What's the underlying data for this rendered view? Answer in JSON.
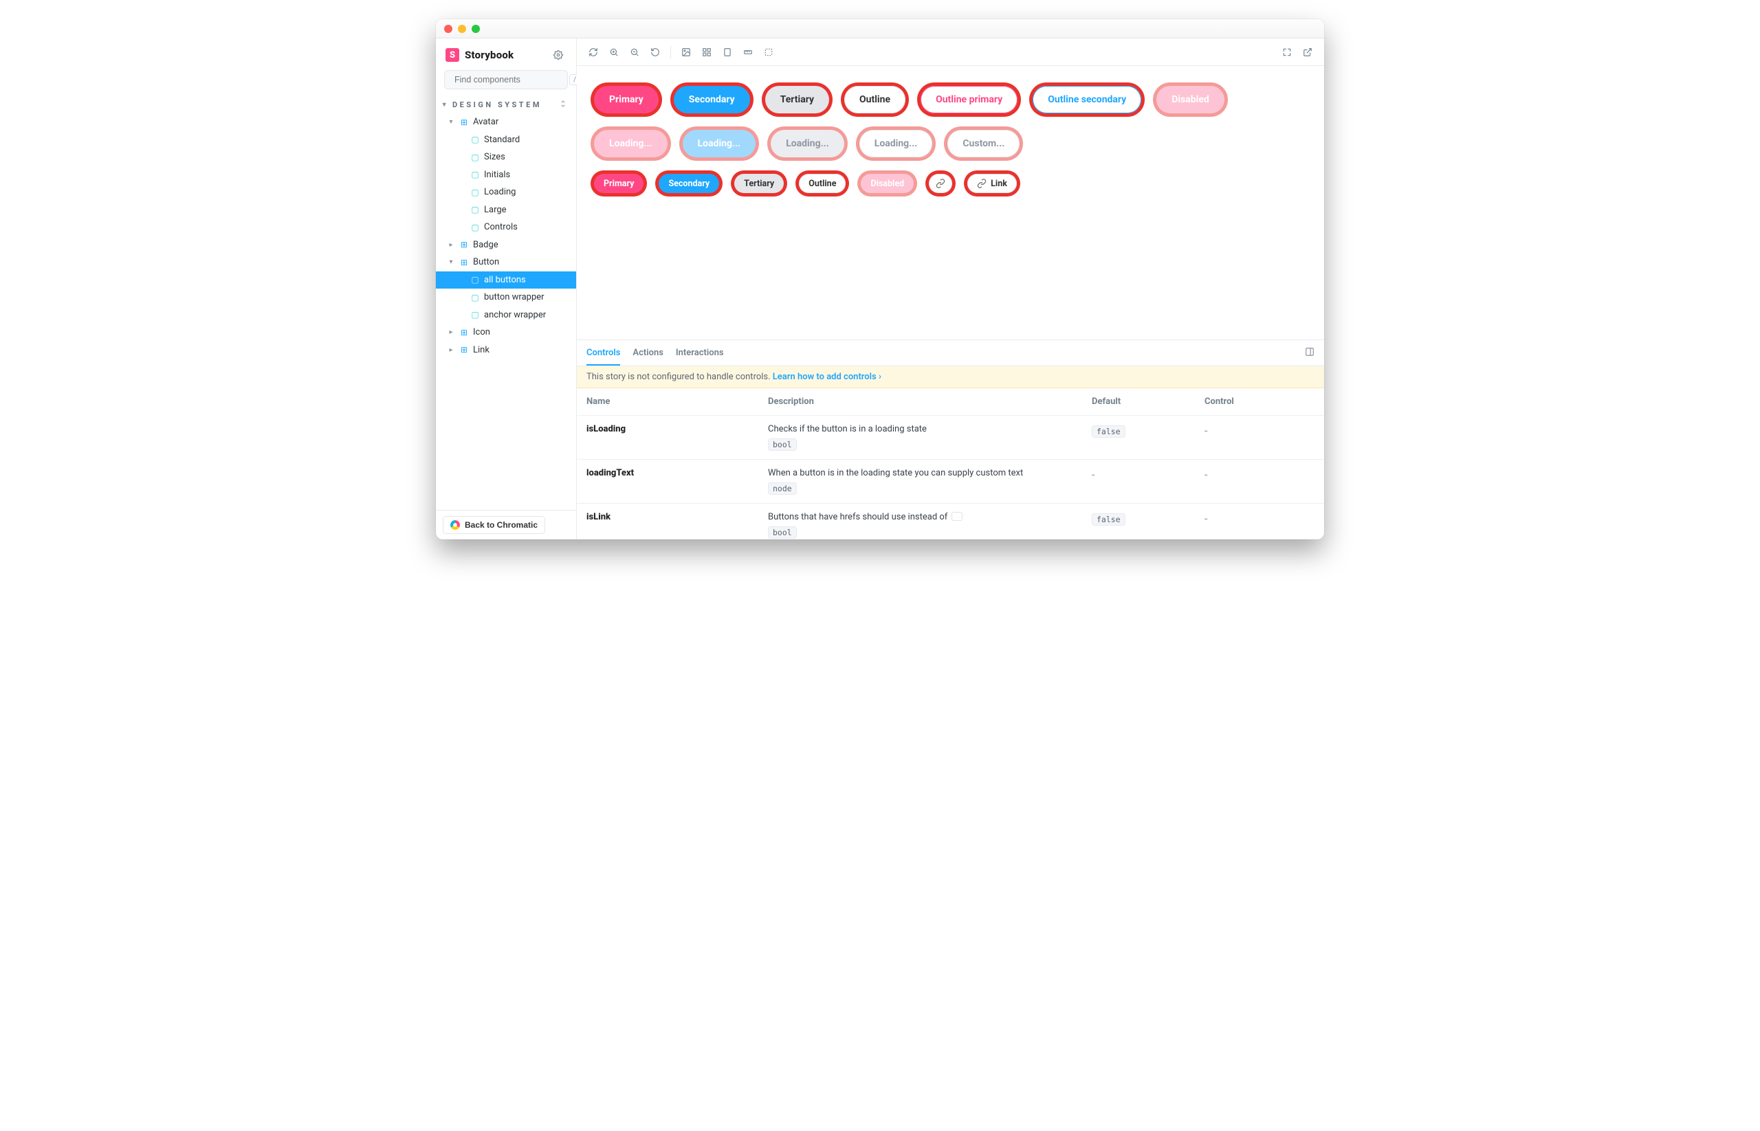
{
  "brand": {
    "name": "Storybook",
    "mark": "S"
  },
  "search": {
    "placeholder": "Find components",
    "shortcut": "/"
  },
  "section": {
    "title": "Design System"
  },
  "nav": [
    {
      "kind": "component",
      "state": "open",
      "label": "Avatar"
    },
    {
      "kind": "story",
      "state": "none",
      "label": "Standard",
      "indent": 2
    },
    {
      "kind": "story",
      "state": "none",
      "label": "Sizes",
      "indent": 2
    },
    {
      "kind": "story",
      "state": "none",
      "label": "Initials",
      "indent": 2
    },
    {
      "kind": "story",
      "state": "none",
      "label": "Loading",
      "indent": 2
    },
    {
      "kind": "story",
      "state": "none",
      "label": "Large",
      "indent": 2
    },
    {
      "kind": "story",
      "state": "none",
      "label": "Controls",
      "indent": 2
    },
    {
      "kind": "component",
      "state": "closed",
      "label": "Badge"
    },
    {
      "kind": "component",
      "state": "open",
      "label": "Button"
    },
    {
      "kind": "story",
      "state": "none",
      "label": "all buttons",
      "indent": 2,
      "selected": true
    },
    {
      "kind": "story",
      "state": "none",
      "label": "button wrapper",
      "indent": 2
    },
    {
      "kind": "story",
      "state": "none",
      "label": "anchor wrapper",
      "indent": 2
    },
    {
      "kind": "component",
      "state": "closed",
      "label": "Icon"
    },
    {
      "kind": "component",
      "state": "closed",
      "label": "Link"
    }
  ],
  "sidebarFooter": {
    "back": "Back to Chromatic"
  },
  "canvas": {
    "rows": [
      {
        "size": "lg",
        "buttons": [
          {
            "label": "Primary",
            "variant": "pink",
            "hl": "#e9322d"
          },
          {
            "label": "Secondary",
            "variant": "blue",
            "hl": "#e9322d"
          },
          {
            "label": "Tertiary",
            "variant": "grey",
            "hl": "#e9322d"
          },
          {
            "label": "Outline",
            "variant": "outl",
            "hl": "#e9322d"
          },
          {
            "label": "Outline primary",
            "variant": "outl-p",
            "hl": "#e9322d"
          },
          {
            "label": "Outline secondary",
            "variant": "outl-s",
            "hl": "#e9322d"
          },
          {
            "label": "Disabled",
            "variant": "pinklt",
            "hl": "#f49b98"
          }
        ]
      },
      {
        "size": "lg",
        "buttons": [
          {
            "label": "Loading...",
            "variant": "pinklt",
            "hl": "#f49b98"
          },
          {
            "label": "Loading...",
            "variant": "bluelt",
            "hl": "#f49b98"
          },
          {
            "label": "Loading...",
            "variant": "greylt",
            "hl": "#f49b98"
          },
          {
            "label": "Loading...",
            "variant": "outllt",
            "hl": "#f49b98"
          },
          {
            "label": "Custom...",
            "variant": "outllt",
            "hl": "#f49b98"
          }
        ]
      },
      {
        "size": "sm",
        "buttons": [
          {
            "label": "Primary",
            "variant": "pink",
            "hl": "#e9322d"
          },
          {
            "label": "Secondary",
            "variant": "blue",
            "hl": "#e9322d"
          },
          {
            "label": "Tertiary",
            "variant": "grey",
            "hl": "#e9322d"
          },
          {
            "label": "Outline",
            "variant": "outl",
            "hl": "#e9322d"
          },
          {
            "label": "Disabled",
            "variant": "pinklt",
            "hl": "#f49b98"
          },
          {
            "icon": "link",
            "label": "",
            "variant": "outl",
            "hl": "#e9322d"
          },
          {
            "icon": "link",
            "label": "Link",
            "variant": "outl",
            "hl": "#e9322d"
          }
        ]
      }
    ]
  },
  "addons": {
    "tabs": [
      "Controls",
      "Actions",
      "Interactions"
    ],
    "activeTab": 0,
    "banner": {
      "text": "This story is not configured to handle controls. ",
      "link": "Learn how to add controls"
    },
    "columns": [
      "Name",
      "Description",
      "Default",
      "Control"
    ],
    "rows": [
      {
        "name": "isLoading",
        "desc": "Checks if the button is in a loading state",
        "type": "bool",
        "def": "false",
        "ctl": "-"
      },
      {
        "name": "loadingText",
        "desc": "When a button is in the loading state you can supply custom text",
        "type": "node",
        "def": "-",
        "ctl": "-"
      },
      {
        "name": "isLink",
        "desc": "Buttons that have hrefs should use instead of ",
        "descHasChip": true,
        "type": "bool",
        "def": "false",
        "ctl": "-"
      }
    ]
  }
}
